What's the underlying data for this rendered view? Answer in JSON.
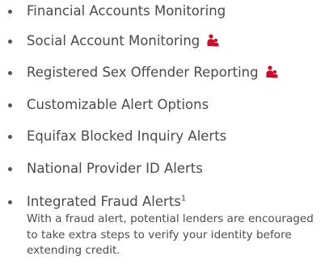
{
  "colors": {
    "text": "#4a4a4a",
    "bullet": "#555555",
    "icon": "#c8102e"
  },
  "features": [
    {
      "label": "Financial Accounts Monitoring",
      "icon": null
    },
    {
      "label": "Social Account Monitoring",
      "icon": "family-icon"
    },
    {
      "label": "Registered Sex Offender Reporting",
      "icon": "family-icon"
    },
    {
      "label": "Customizable Alert Options",
      "icon": null
    },
    {
      "label": "Equifax Blocked Inquiry Alerts",
      "icon": null
    },
    {
      "label": "National Provider ID Alerts",
      "icon": null
    },
    {
      "label": "Integrated Fraud Alerts",
      "footnote": "1",
      "note": "With a fraud alert, potential lenders are encouraged to take extra steps to verify your identity before extending credit."
    }
  ]
}
